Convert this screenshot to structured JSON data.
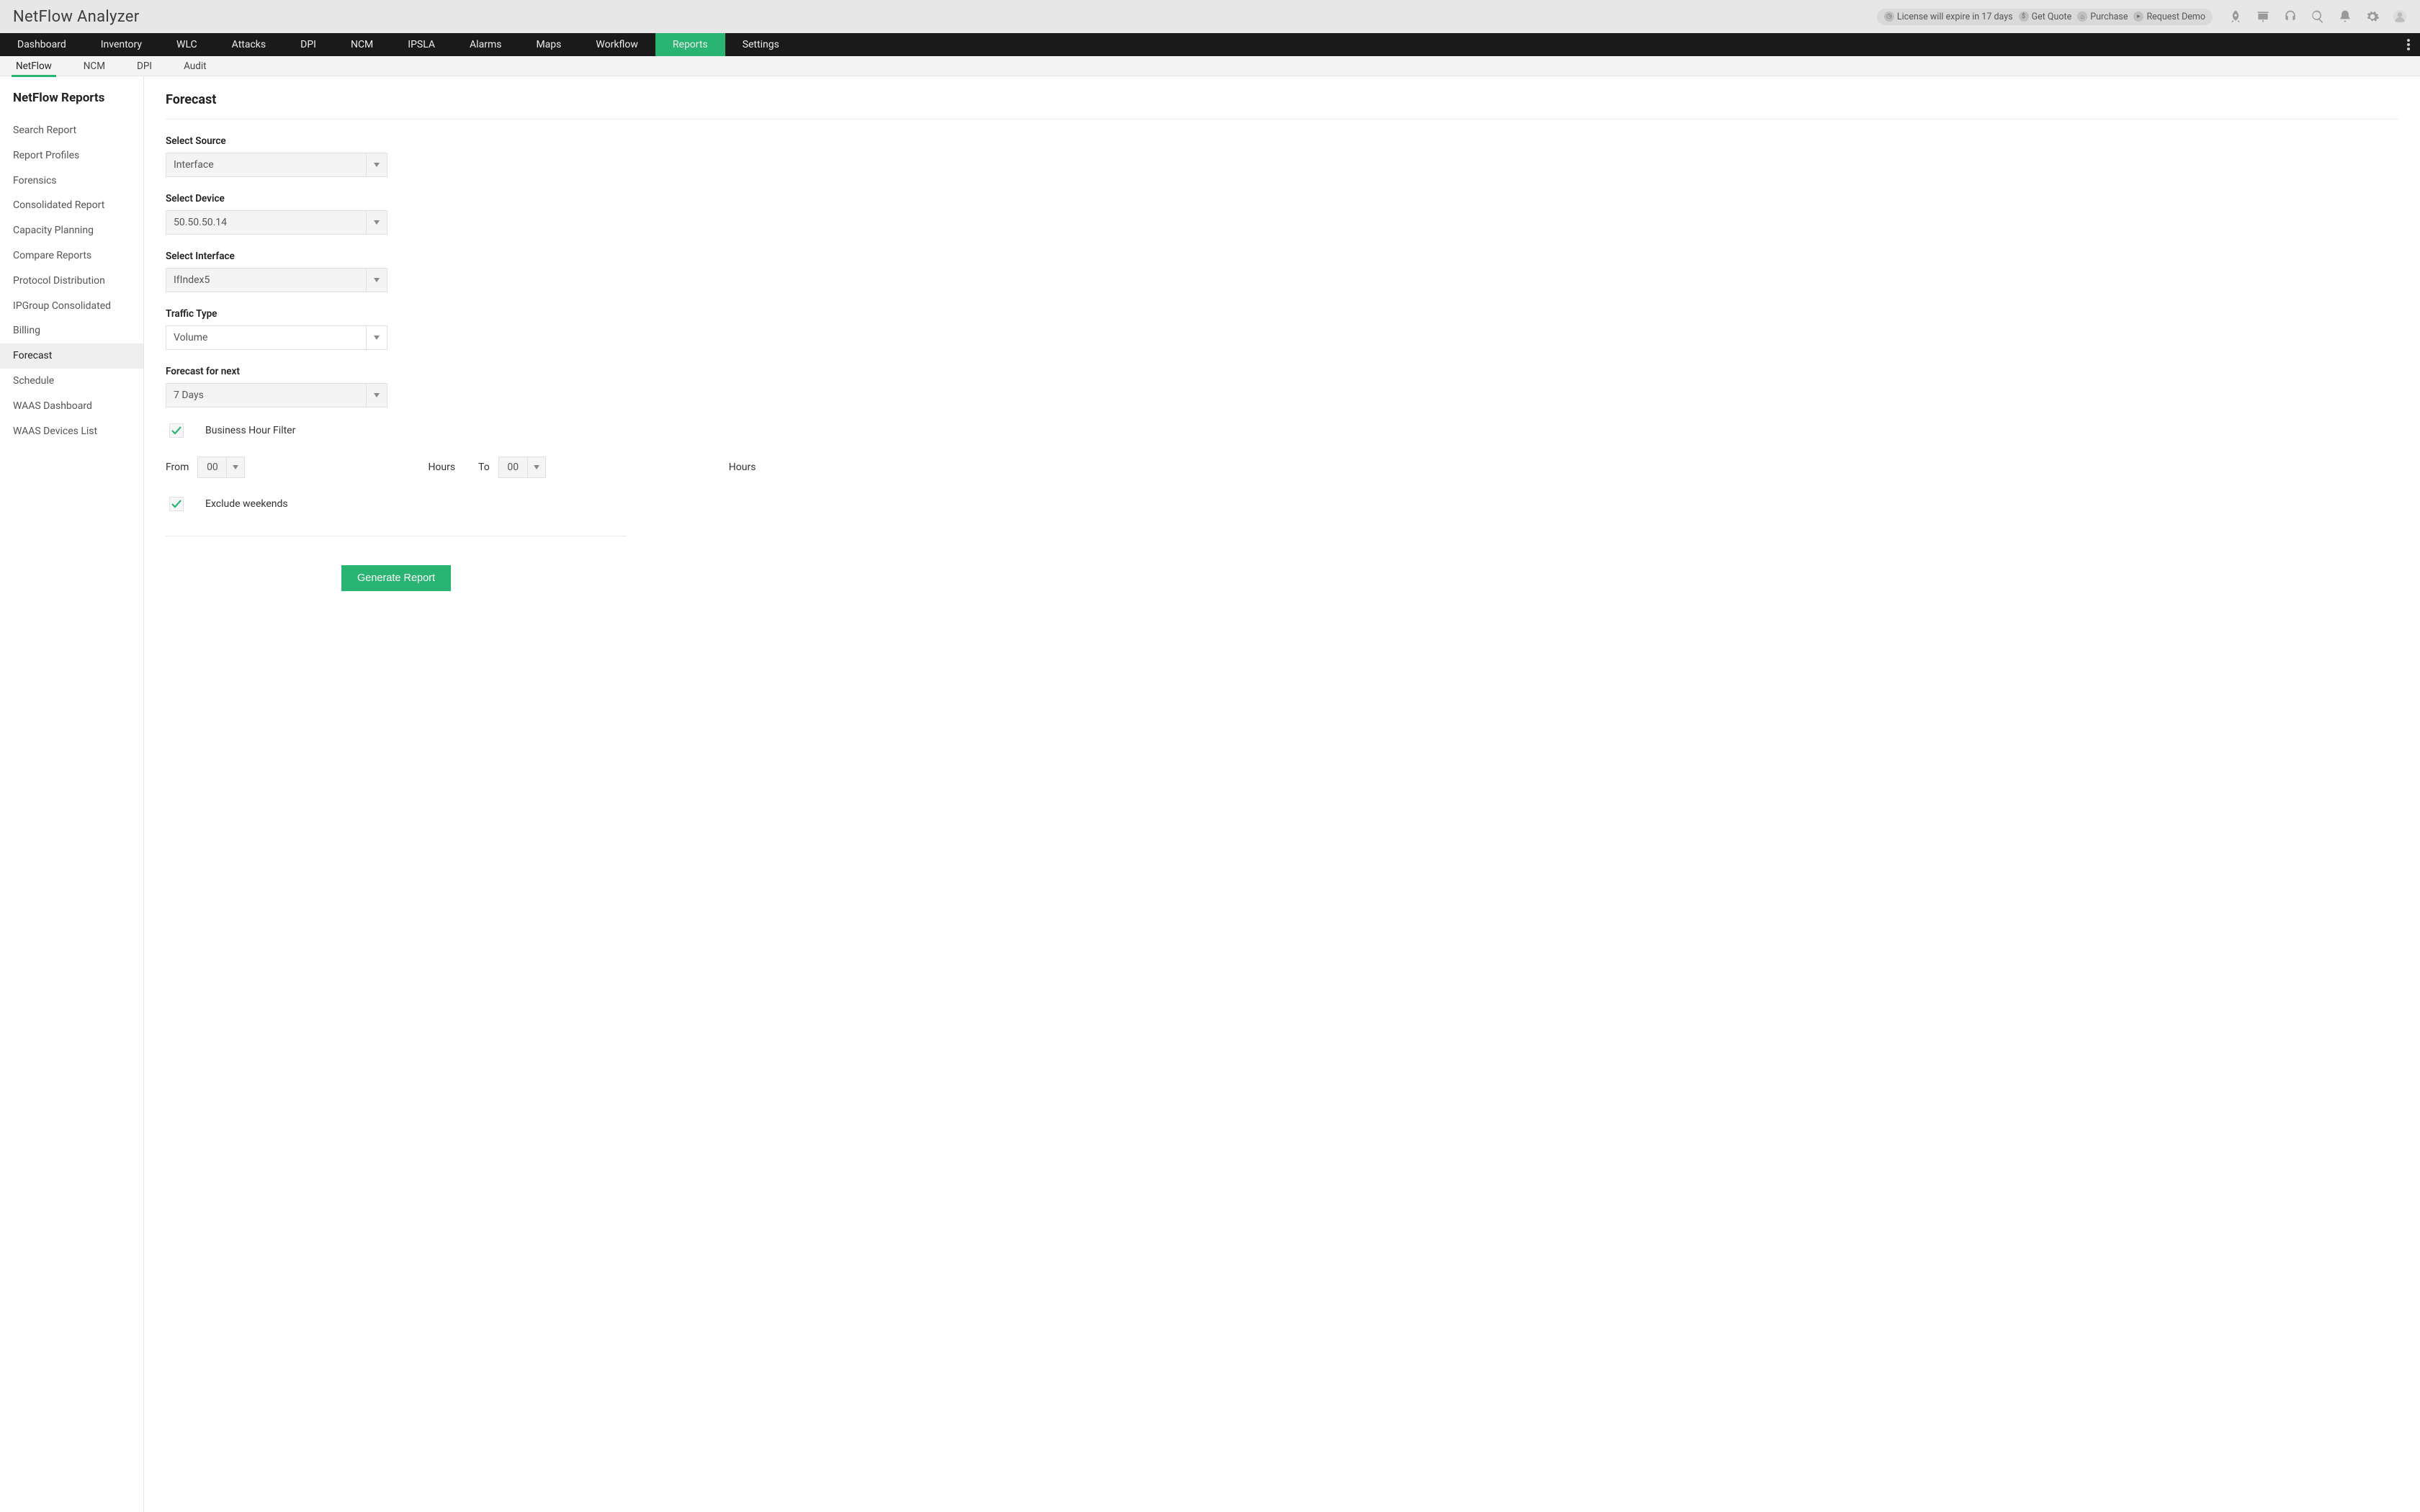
{
  "header": {
    "app_title": "NetFlow Analyzer",
    "license_pill": {
      "expire_text": "License will expire in 17 days",
      "get_quote": "Get Quote",
      "purchase": "Purchase",
      "request_demo": "Request Demo"
    }
  },
  "primary_nav": {
    "items": [
      "Dashboard",
      "Inventory",
      "WLC",
      "Attacks",
      "DPI",
      "NCM",
      "IPSLA",
      "Alarms",
      "Maps",
      "Workflow",
      "Reports",
      "Settings"
    ],
    "active_index": 10
  },
  "secondary_nav": {
    "items": [
      "NetFlow",
      "NCM",
      "DPI",
      "Audit"
    ],
    "active_index": 0
  },
  "sidebar": {
    "title": "NetFlow Reports",
    "items": [
      "Search Report",
      "Report Profiles",
      "Forensics",
      "Consolidated Report",
      "Capacity Planning",
      "Compare Reports",
      "Protocol Distribution",
      "IPGroup Consolidated",
      "Billing",
      "Forecast",
      "Schedule",
      "WAAS Dashboard",
      "WAAS Devices List"
    ],
    "active_index": 9
  },
  "main": {
    "page_title": "Forecast",
    "form": {
      "select_source": {
        "label": "Select Source",
        "value": "Interface"
      },
      "select_device": {
        "label": "Select Device",
        "value": "50.50.50.14"
      },
      "select_interface": {
        "label": "Select Interface",
        "value": "IfIndex5"
      },
      "traffic_type": {
        "label": "Traffic Type",
        "value": "Volume"
      },
      "forecast_for_next": {
        "label": "Forecast for next",
        "value": "7 Days"
      },
      "business_hour_filter": {
        "label": "Business Hour Filter",
        "checked": true
      },
      "hours": {
        "from_label": "From",
        "from_value": "00",
        "from_unit": "Hours",
        "to_label": "To",
        "to_value": "00",
        "to_unit": "Hours"
      },
      "exclude_weekends": {
        "label": "Exclude weekends",
        "checked": true
      },
      "submit_label": "Generate Report"
    }
  },
  "colors": {
    "accent": "#29b473"
  }
}
